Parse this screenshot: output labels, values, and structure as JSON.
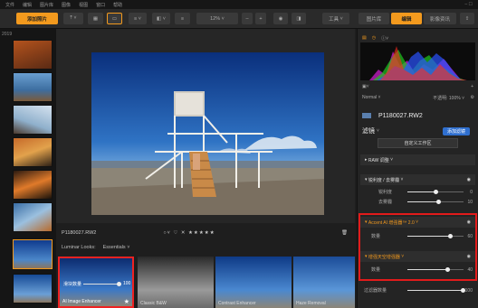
{
  "menu": [
    "文件",
    "编辑",
    "图片库",
    "图像",
    "视图",
    "窗口",
    "帮助"
  ],
  "toolbar": {
    "add_photos": "添加照片",
    "zoom": "12%",
    "tools_label": "工具",
    "tab_library": "图片库",
    "tab_edit": "编辑",
    "tab_info": "影像资讯"
  },
  "filmstrip": {
    "year_label": "2019"
  },
  "canvas": {
    "filename": "P1180027.RW2",
    "rating_icons": "○˅ ♡ ✕ ★★★★★"
  },
  "looks": {
    "header_left": "Luminar Looks:",
    "header_right": "Essentials",
    "items": [
      {
        "name": "AI Image Enhancer",
        "slider_label": "滑块数量",
        "slider_value": "100"
      },
      {
        "name": "Classic B&W",
        "slider_label": "",
        "slider_value": ""
      },
      {
        "name": "Contrast Enhancer",
        "slider_label": "",
        "slider_value": ""
      },
      {
        "name": "Haze Removal",
        "slider_label": "",
        "slider_value": ""
      }
    ]
  },
  "panel": {
    "blend_mode": "Normal",
    "opacity_label": "不透明: 100%",
    "file_name": "P1180027.RW2",
    "filters_title": "滤镜",
    "add_filter_button": "添加滤镜",
    "workspace_button": "自定义工作区",
    "raw_section": "RAW 调整",
    "sharpness_section": "锐利度 / 去雾霾",
    "sharpness_rows": [
      {
        "label": "锐利度",
        "value": "0"
      },
      {
        "label": "去雾霾",
        "value": "10"
      }
    ],
    "accent_section": "Accent AI 增强器™ 2.0",
    "accent_row": {
      "label": "数量",
      "value": "60"
    },
    "ai_sky_section": "增强天空增强器",
    "ai_sky_row": {
      "label": "数量",
      "value": "40"
    },
    "overall_row": {
      "label": "过滤器数量",
      "value": "100"
    }
  },
  "colors": {
    "accent": "#f39a1e",
    "highlight_red": "#e21b1b"
  }
}
